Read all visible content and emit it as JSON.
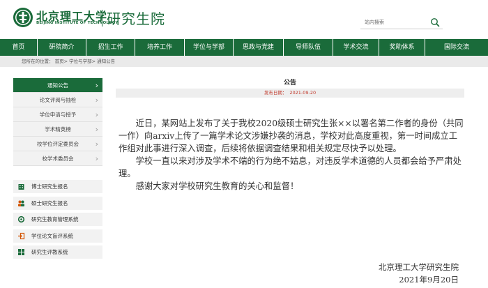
{
  "header": {
    "logo_cn": "北京理工大学",
    "logo_en": "BEIJING INSTITUTE OF TECHNOLOGY",
    "site_name": "研究生院",
    "search_placeholder": "站内搜索",
    "search_icon": "search-icon"
  },
  "nav": {
    "items": [
      "首页",
      "研院简介",
      "招生工作",
      "培养工作",
      "学位与学部",
      "思政与党建",
      "导师队伍",
      "学术交流",
      "奖助体系",
      "国际交流"
    ]
  },
  "breadcrumb": "您所在的位置： 首页> 学位与学部> 通知公告",
  "sidebar": {
    "items": [
      {
        "label": "通知公告",
        "active": true
      },
      {
        "label": "论文评阅与抽检"
      },
      {
        "label": "学位申请与授予"
      },
      {
        "label": "学术精英榜"
      },
      {
        "label": "校学位评定委员会"
      },
      {
        "label": "校学术委员会"
      }
    ],
    "links": [
      {
        "label": "博士研究生报名",
        "icon": "building-icon"
      },
      {
        "label": "硕士研究生报名",
        "icon": "users-icon"
      },
      {
        "label": "研究生教育管理系统",
        "icon": "settings-icon"
      },
      {
        "label": "学位论文盲评系统",
        "icon": "login-icon"
      },
      {
        "label": "研究生评教系统",
        "icon": "grid-icon"
      }
    ]
  },
  "article": {
    "title": "公告",
    "date_label": "发布日期：",
    "date": "2021-09-20",
    "paragraphs": [
      "近日，某网站上发布了关于我校2020级硕士研究生张××以署名第二作者的身份（共同一作）向arxiv上传了一篇学术论文涉嫌抄袭的消息，学校对此高度重视，第一时间成立工作组对此事进行深入调查，后续将依据调查结果和相关规定尽快予以处理。",
      "学校一直以来对涉及学术不端的行为绝不姑息，对违反学术道德的人员都会给予严肃处理。",
      "感谢大家对学校研究生教育的关心和监督！"
    ],
    "signature": "北京理工大学研究生院",
    "signature_date": "2021年9月20日"
  },
  "colors": {
    "brand_green": "#1a6b3a",
    "date_red": "#c0392b"
  }
}
